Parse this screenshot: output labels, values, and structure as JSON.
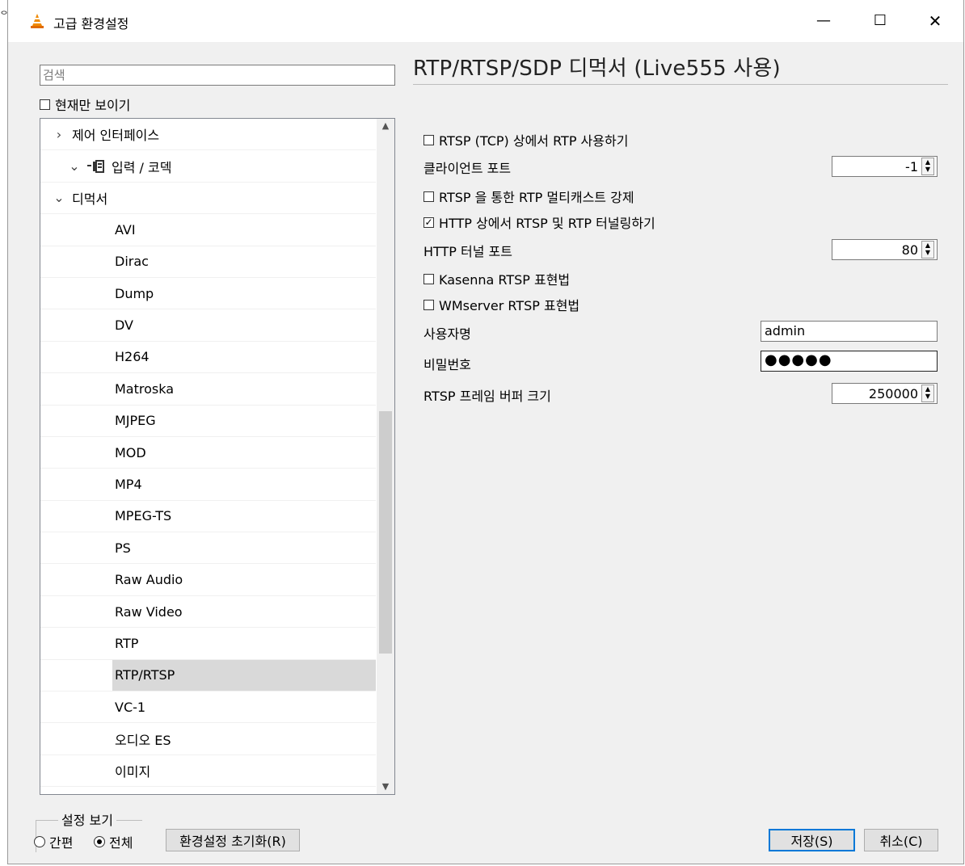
{
  "window": {
    "title": "고급 환경설정",
    "edge_glyph": "ᄋ",
    "controls": {
      "minimize": "—",
      "maximize": "☐",
      "close": "✕"
    }
  },
  "left": {
    "search": {
      "placeholder": "검색",
      "value": ""
    },
    "current_only": {
      "label": "현재만 보이기",
      "checked": false
    },
    "tree": [
      {
        "label": "제어 인터페이스",
        "level": 1,
        "expander": "›"
      },
      {
        "label": "입력 / 코덱",
        "level": 0,
        "expander": "⌄",
        "icon": "input-codec-icon"
      },
      {
        "label": "디먹서",
        "level": 1,
        "expander": "⌄"
      },
      {
        "label": "AVI",
        "level": 2
      },
      {
        "label": "Dirac",
        "level": 2
      },
      {
        "label": "Dump",
        "level": 2
      },
      {
        "label": "DV",
        "level": 2
      },
      {
        "label": "H264",
        "level": 2
      },
      {
        "label": "Matroska",
        "level": 2
      },
      {
        "label": "MJPEG",
        "level": 2
      },
      {
        "label": "MOD",
        "level": 2
      },
      {
        "label": "MP4",
        "level": 2
      },
      {
        "label": "MPEG-TS",
        "level": 2
      },
      {
        "label": "PS",
        "level": 2
      },
      {
        "label": "Raw Audio",
        "level": 2
      },
      {
        "label": "Raw Video",
        "level": 2
      },
      {
        "label": "RTP",
        "level": 2
      },
      {
        "label": "RTP/RTSP",
        "level": 2,
        "selected": true
      },
      {
        "label": "VC-1",
        "level": 2
      },
      {
        "label": "오디오 ES",
        "level": 2
      },
      {
        "label": "이미지",
        "level": 2
      }
    ]
  },
  "panel": {
    "title": "RTP/RTSP/SDP 디먹서 (Live555 사용)",
    "rtsp_tcp": {
      "label": "RTSP (TCP) 상에서 RTP 사용하기",
      "checked": false
    },
    "client_port": {
      "label": "클라이언트 포트",
      "value": "-1"
    },
    "force_multicast": {
      "label": "RTSP 을 통한 RTP 멀티캐스트 강제",
      "checked": false
    },
    "http_tunnel": {
      "label": "HTTP 상에서 RTSP 및 RTP 터널링하기",
      "checked": true
    },
    "http_tunnel_port": {
      "label": "HTTP 터널 포트",
      "value": "80"
    },
    "kasenna": {
      "label": "Kasenna RTSP 표현법",
      "checked": false
    },
    "wmserver": {
      "label": "WMserver RTSP 표현법",
      "checked": false
    },
    "username": {
      "label": "사용자명",
      "value": "admin"
    },
    "password": {
      "label": "비밀번호",
      "value": "●●●●●"
    },
    "frame_buffer": {
      "label": "RTSP 프레임 버퍼 크기",
      "value": "250000"
    }
  },
  "bottom": {
    "group_label": "설정 보기",
    "radio_simple": {
      "label": "간편",
      "selected": false
    },
    "radio_all": {
      "label": "전체",
      "selected": true
    },
    "reset_button": "환경설정 초기화(R)",
    "save_button": "저장(S)",
    "cancel_button": "취소(C)"
  }
}
